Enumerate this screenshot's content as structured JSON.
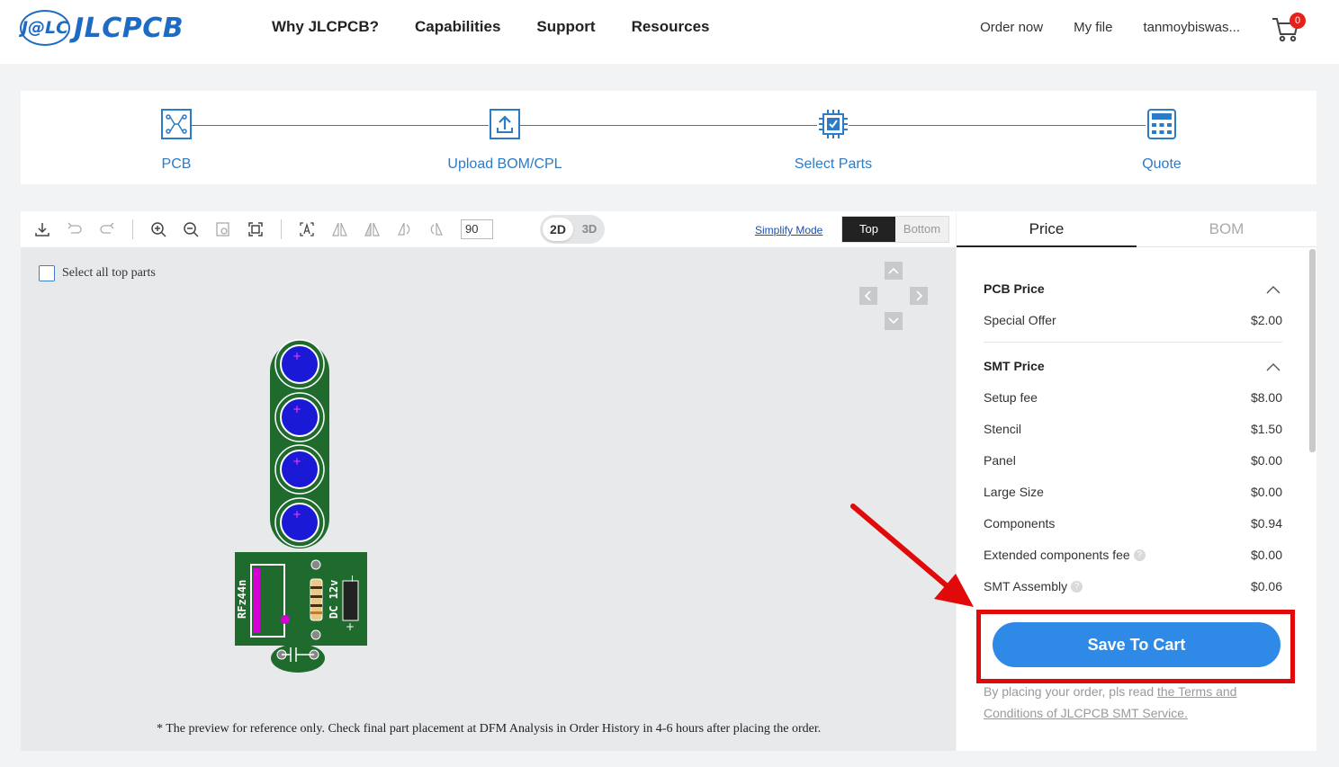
{
  "header": {
    "logo_mark": "J@LC",
    "logo_text": "JLCPCB",
    "nav": [
      "Why JLCPCB?",
      "Capabilities",
      "Support",
      "Resources"
    ],
    "order_now": "Order now",
    "my_file": "My file",
    "username": "tanmoybiswas...",
    "cart_count": "0"
  },
  "steps": [
    {
      "label": "PCB"
    },
    {
      "label": "Upload BOM/CPL"
    },
    {
      "label": "Select Parts"
    },
    {
      "label": "Quote"
    }
  ],
  "viewer": {
    "rotation_value": "90",
    "dim_2d": "2D",
    "dim_3d": "3D",
    "simplify_mode": "Simplify Mode",
    "side_top": "Top",
    "side_bottom": "Bottom",
    "select_all": "Select all top parts",
    "preview_note": "* The preview for reference only. Check final part placement at DFM Analysis in Order History in 4-6 hours after placing the order.",
    "pcb_silk_1": "RFz44n",
    "pcb_silk_2": "DC 12v"
  },
  "panel": {
    "tab_price": "Price",
    "tab_bom": "BOM",
    "pcb_price_title": "PCB Price",
    "pcb_rows": [
      {
        "label": "Special Offer",
        "value": "$2.00"
      }
    ],
    "smt_price_title": "SMT Price",
    "smt_rows": [
      {
        "label": "Setup fee",
        "value": "$8.00"
      },
      {
        "label": "Stencil",
        "value": "$1.50"
      },
      {
        "label": "Panel",
        "value": "$0.00"
      },
      {
        "label": "Large Size",
        "value": "$0.00"
      },
      {
        "label": "Components",
        "value": "$0.94"
      },
      {
        "label": "Extended components fee",
        "value": "$0.00"
      },
      {
        "label": "SMT Assembly",
        "value": "$0.06"
      }
    ],
    "save_button": "Save To Cart",
    "terms_prefix": "By placing your order, pls read ",
    "terms_link": "the Terms and Conditions of JLCPCB SMT Service."
  },
  "colors": {
    "accent": "#2c7bc6",
    "save_button": "#2e8ae6",
    "highlight": "#e10a0a",
    "pcb_green": "#1f6b2d"
  }
}
